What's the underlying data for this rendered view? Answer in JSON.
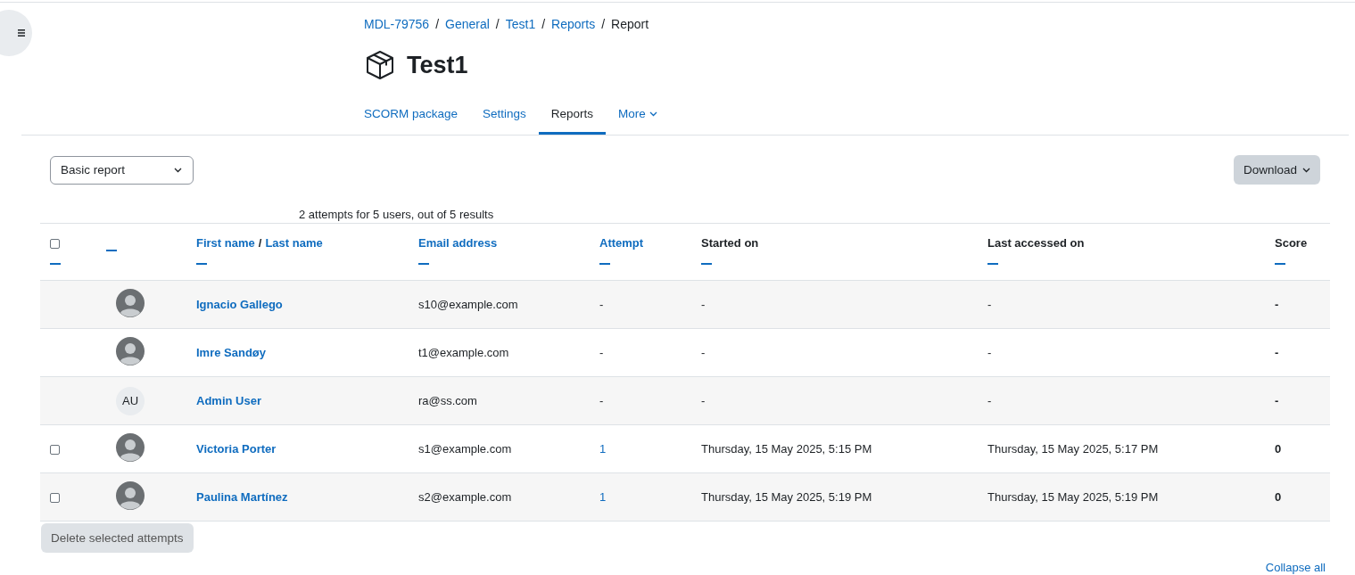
{
  "breadcrumbs": [
    {
      "label": "MDL-79756",
      "kind": "link"
    },
    {
      "kind": "separator",
      "label": "/"
    },
    {
      "label": "General",
      "kind": "link"
    },
    {
      "kind": "separator",
      "label": "/"
    },
    {
      "label": "Test1",
      "kind": "link"
    },
    {
      "kind": "separator",
      "label": "/"
    },
    {
      "label": "Reports",
      "kind": "link"
    },
    {
      "kind": "separator",
      "label": "/"
    },
    {
      "label": "Report",
      "kind": "current"
    }
  ],
  "page_title": "Test1",
  "tabs": [
    {
      "label": "SCORM package",
      "selected": false,
      "dropdown": false
    },
    {
      "label": "Settings",
      "selected": false,
      "dropdown": false
    },
    {
      "label": "Reports",
      "selected": true,
      "dropdown": false
    },
    {
      "label": "More",
      "selected": false,
      "dropdown": true
    }
  ],
  "report_select": {
    "value": "Basic report"
  },
  "download_button": "Download",
  "summary": "2 attempts for 5 users, out of 5 results",
  "table": {
    "select_all": {
      "checked": false
    },
    "columns": [
      {},
      {},
      {
        "parts": [
          {
            "label": "First name",
            "kind": "link"
          },
          {
            "label": "/",
            "kind": "text"
          },
          {
            "label": "Last name",
            "kind": "link"
          }
        ]
      },
      {
        "parts": [
          {
            "label": "Email address",
            "kind": "link"
          }
        ]
      },
      {
        "parts": [
          {
            "label": "Attempt",
            "kind": "link"
          }
        ]
      },
      {
        "parts": [
          {
            "label": "Started on",
            "kind": "text"
          }
        ]
      },
      {
        "parts": [
          {
            "label": "Last accessed on",
            "kind": "text"
          }
        ]
      },
      {
        "parts": [
          {
            "label": "Score",
            "kind": "text"
          }
        ]
      }
    ],
    "rows": [
      {
        "avatar": {
          "kind": "photo"
        },
        "name": "Ignacio Gallego",
        "email": "s10@example.com",
        "attempt": "-",
        "attempt_link": false,
        "started": "-",
        "last_accessed": "-",
        "score": "-"
      },
      {
        "avatar": {
          "kind": "photo"
        },
        "name": "Imre Sandøy",
        "email": "t1@example.com",
        "attempt": "-",
        "attempt_link": false,
        "started": "-",
        "last_accessed": "-",
        "score": "-"
      },
      {
        "avatar": {
          "kind": "initials",
          "text": "AU"
        },
        "name": "Admin User",
        "email": "ra@ss.com",
        "attempt": "-",
        "attempt_link": false,
        "started": "-",
        "last_accessed": "-",
        "score": "-"
      },
      {
        "checkbox": {
          "checked": false
        },
        "avatar": {
          "kind": "photo"
        },
        "name": "Victoria Porter",
        "email": "s1@example.com",
        "attempt": "1",
        "attempt_link": true,
        "started": "Thursday, 15 May 2025, 5:15 PM",
        "last_accessed": "Thursday, 15 May 2025, 5:17 PM",
        "score": "0"
      },
      {
        "checkbox": {
          "checked": false
        },
        "avatar": {
          "kind": "photo"
        },
        "name": "Paulina Martínez",
        "email": "s2@example.com",
        "attempt": "1",
        "attempt_link": true,
        "started": "Thursday, 15 May 2025, 5:19 PM",
        "last_accessed": "Thursday, 15 May 2025, 5:19 PM",
        "score": "0"
      }
    ]
  },
  "delete_button": {
    "label": "Delete selected attempts",
    "disabled": true
  },
  "collapse_all": "Collapse all"
}
